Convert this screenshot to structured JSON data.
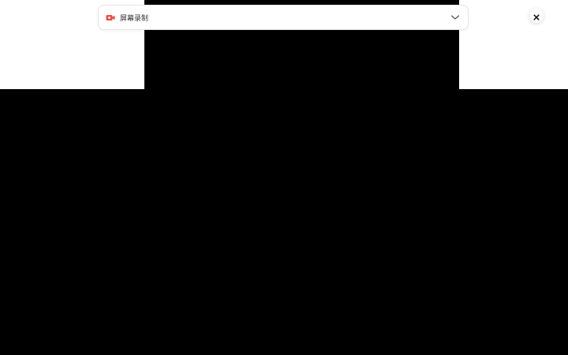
{
  "recorder": {
    "source_label": "屏幕录制",
    "source_icon": "video-camera-icon",
    "dropdown_icon": "chevron-down-icon",
    "close_icon": "close-icon",
    "accent_color": "#e8514a"
  }
}
